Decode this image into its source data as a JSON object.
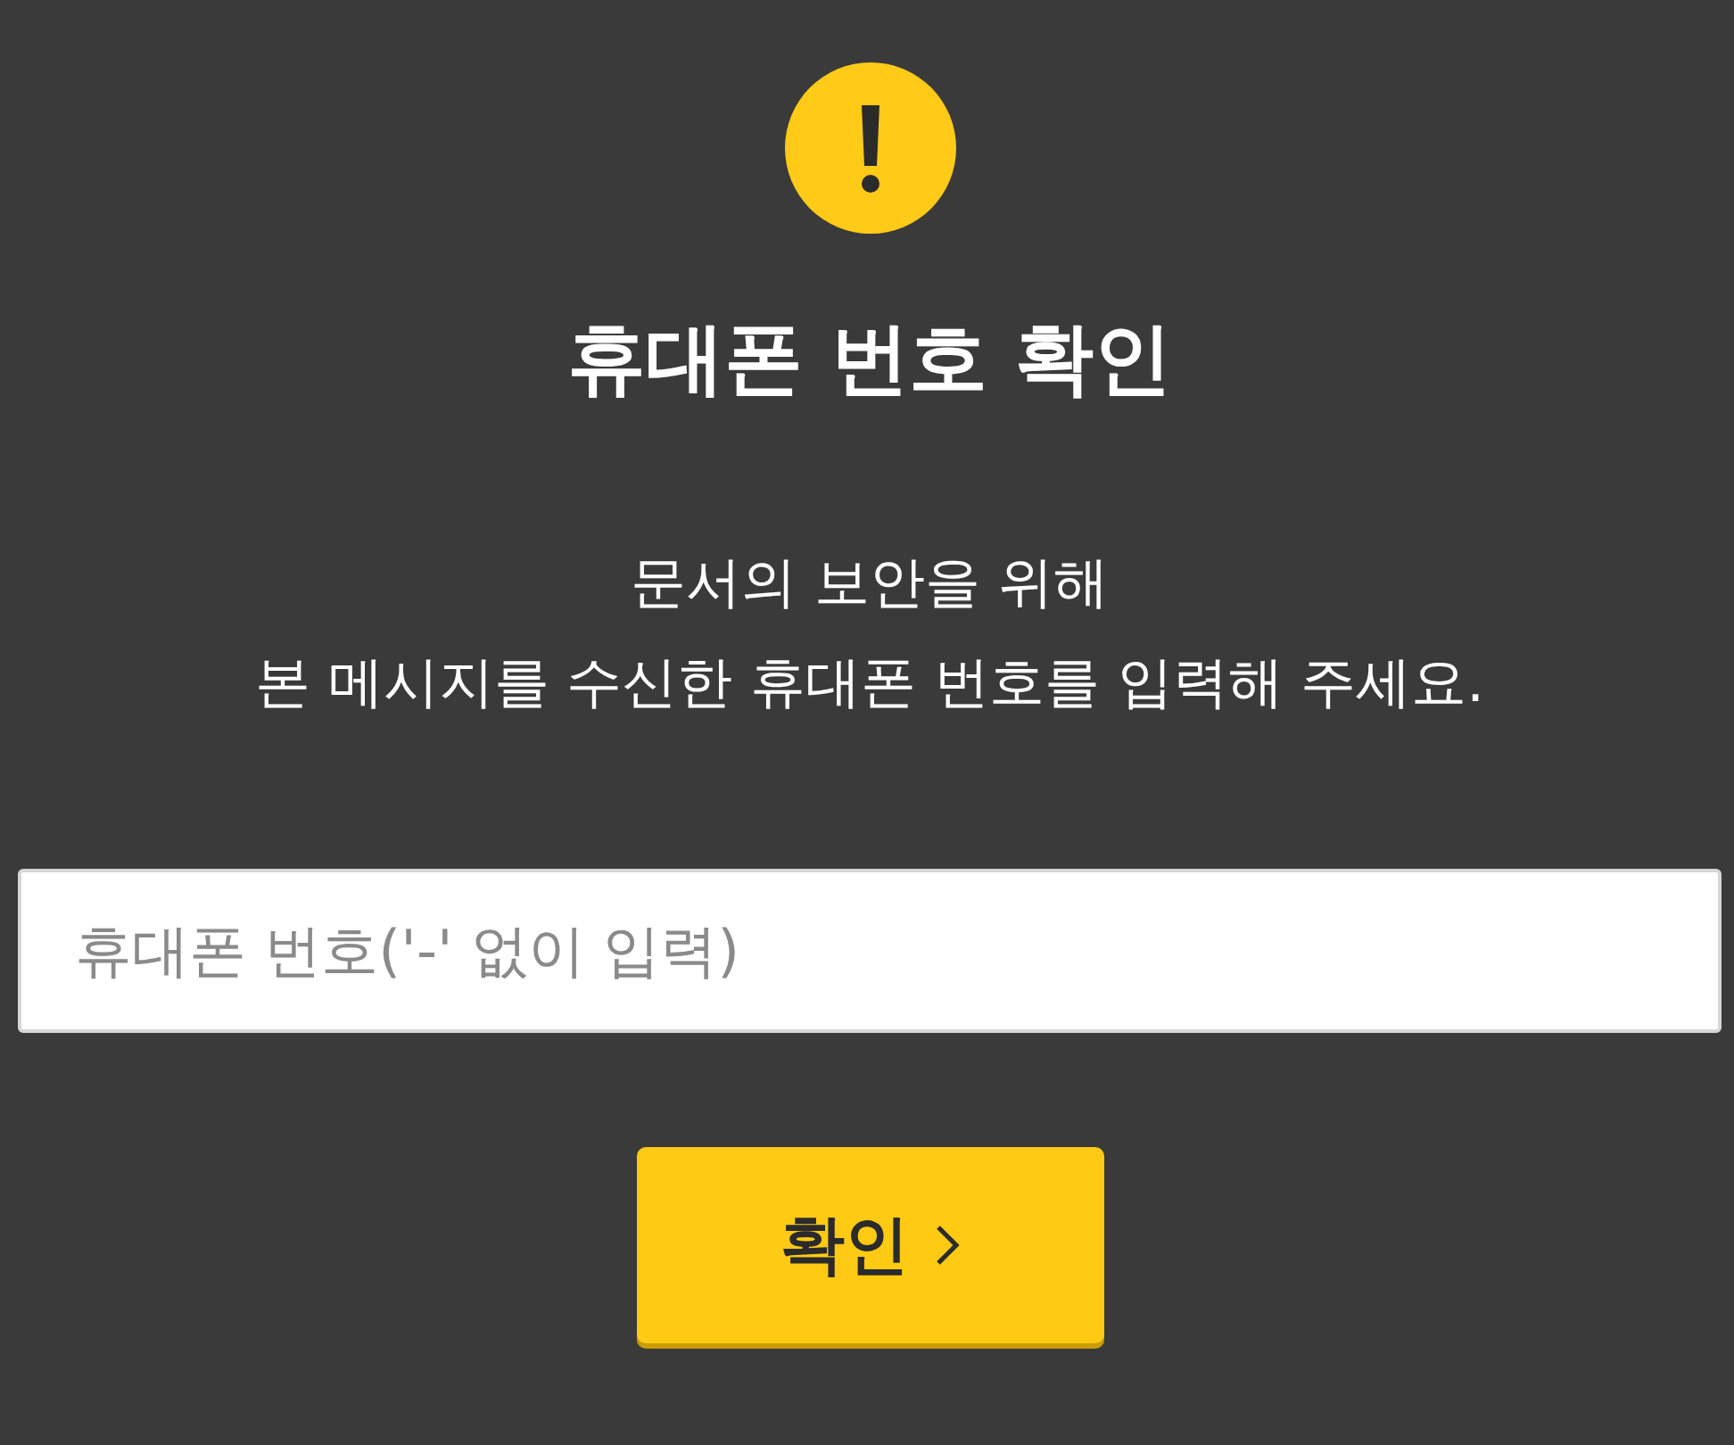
{
  "dialog": {
    "title": "휴대폰 번호 확인",
    "message_lines": [
      "문서의 보안을 위해",
      "본 메시지를 수신한 휴대폰 번호를 입력해 주세요."
    ],
    "phone_field": {
      "placeholder": "휴대폰 번호('-' 없이 입력)"
    },
    "confirm_button": {
      "label": "확인"
    }
  }
}
